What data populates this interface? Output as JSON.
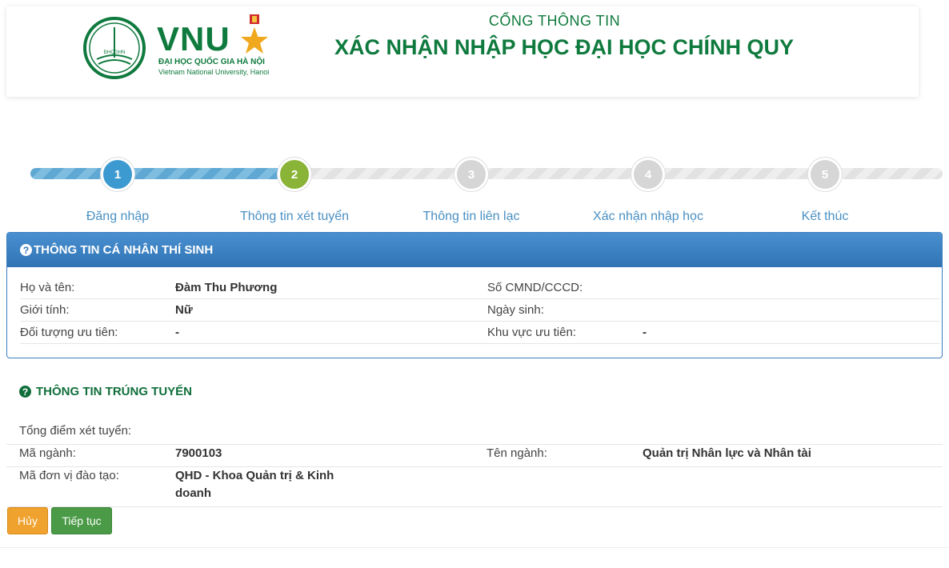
{
  "header": {
    "logo_badge": "ĐHQGHN",
    "brand": "VNU",
    "brand_sub1": "ĐẠI HỌC QUỐC GIA HÀ NỘI",
    "brand_sub2": "Vietnam National University, Hanoi",
    "portal_small": "CỔNG THÔNG TIN",
    "portal_big": "XÁC NHẬN NHẬP HỌC ĐẠI HỌC CHÍNH QUY"
  },
  "wizard": {
    "steps": [
      {
        "num": "1",
        "label": "Đăng nhập",
        "state": "done"
      },
      {
        "num": "2",
        "label": "Thông tin xét tuyển",
        "state": "current"
      },
      {
        "num": "3",
        "label": "Thông tin liên lạc",
        "state": "todo"
      },
      {
        "num": "4",
        "label": "Xác nhận nhập học",
        "state": "todo"
      },
      {
        "num": "5",
        "label": "Kết thúc",
        "state": "todo"
      }
    ],
    "colors": {
      "done": "#3d9ad1",
      "current": "#8ab437",
      "todo": "#d6d6d6"
    }
  },
  "personal": {
    "title": "THÔNG TIN CÁ NHÂN THÍ SINH",
    "icon": "question-circle-icon",
    "fullname_label": "Họ và tên:",
    "fullname_value": "Đàm Thu Phương",
    "id_label": "Số CMND/CCCD:",
    "id_value": "",
    "gender_label": "Giới tính:",
    "gender_value": "Nữ",
    "dob_label": "Ngày sinh:",
    "dob_value": "",
    "priority_label": "Đối tượng ưu tiên:",
    "priority_value": "-",
    "region_label": "Khu vực ưu tiên:",
    "region_value": "-"
  },
  "admission": {
    "title": "THÔNG TIN TRÚNG TUYỂN",
    "icon": "question-circle-icon",
    "score_label": "Tổng điểm xét tuyển:",
    "score_value": "",
    "major_code_label": "Mã ngành:",
    "major_code_value": "7900103",
    "major_name_label": "Tên ngành:",
    "major_name_value": "Quản trị Nhân lực và Nhân tài",
    "unit_label": "Mã đơn vị đào tạo:",
    "unit_value_line1": "QHD - Khoa Quản trị & Kinh",
    "unit_value_line2": "doanh"
  },
  "actions": {
    "cancel_label": "Hủy",
    "next_label": "Tiếp tục"
  },
  "colors": {
    "brand_green": "#0f7a3e",
    "panel_blue": "#2f74b5",
    "cancel_orange": "#f0a22e",
    "next_green": "#4a9a47"
  }
}
